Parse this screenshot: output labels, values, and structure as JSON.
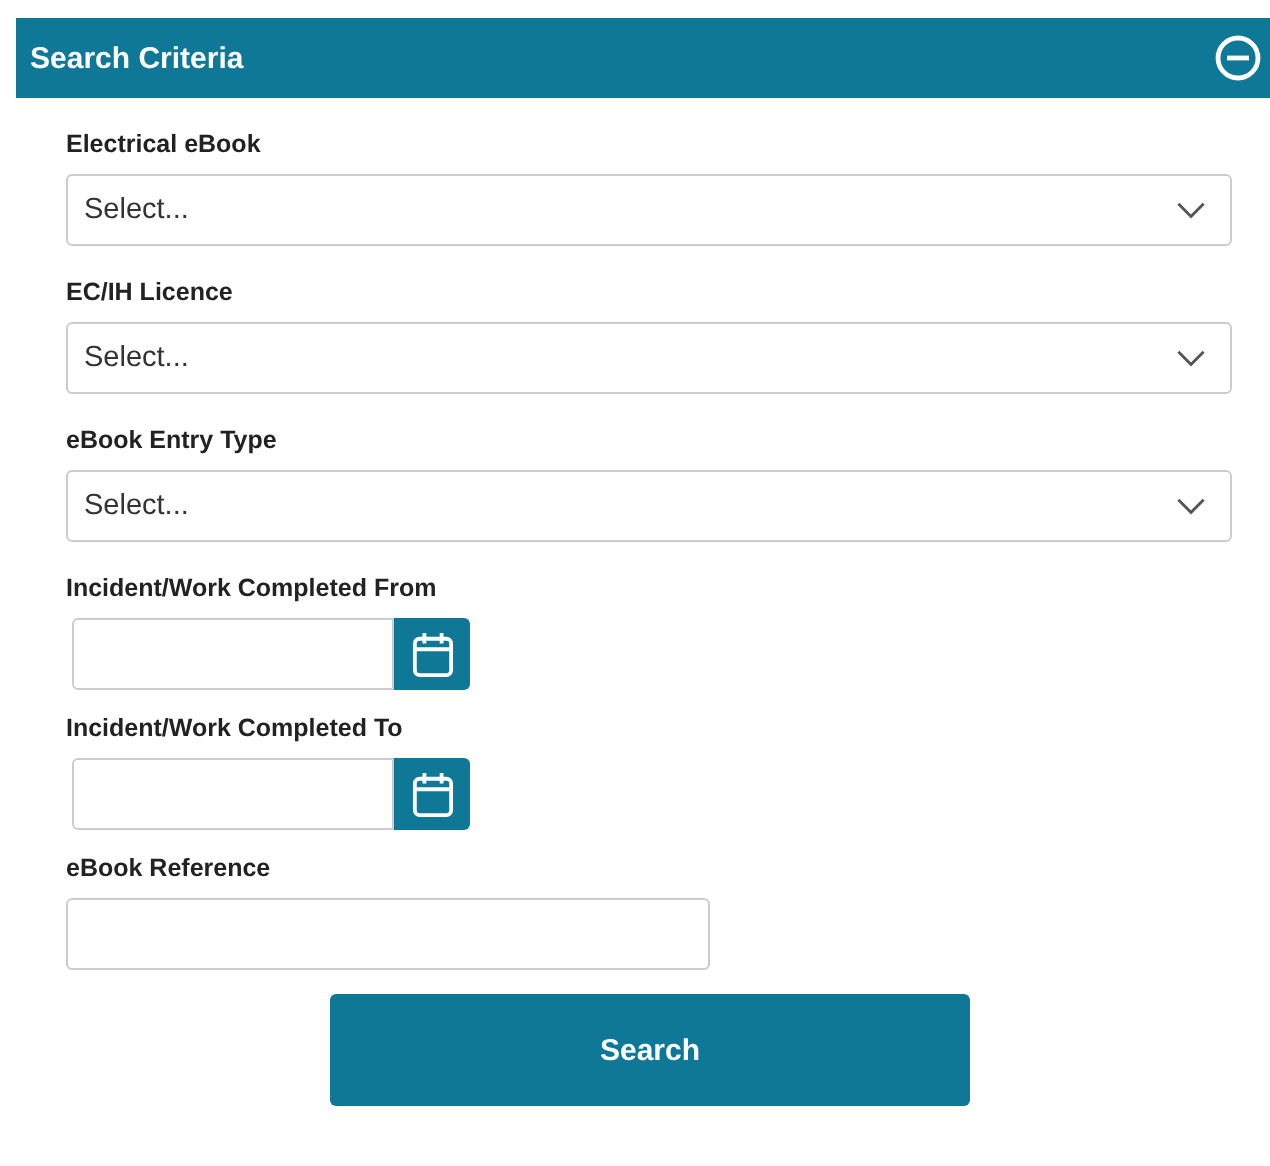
{
  "panel": {
    "title": "Search Criteria"
  },
  "fields": [
    {
      "kind": "select",
      "label": "Electrical eBook",
      "value": "Select..."
    },
    {
      "kind": "select",
      "label": "EC/IH Licence",
      "value": "Select..."
    },
    {
      "kind": "select",
      "label": "eBook Entry Type",
      "value": "Select..."
    },
    {
      "kind": "date",
      "label": "Incident/Work Completed From"
    },
    {
      "kind": "date",
      "label": "Incident/Work Completed To"
    },
    {
      "kind": "text",
      "label": "eBook Reference"
    }
  ],
  "buttons": [
    "Search"
  ]
}
